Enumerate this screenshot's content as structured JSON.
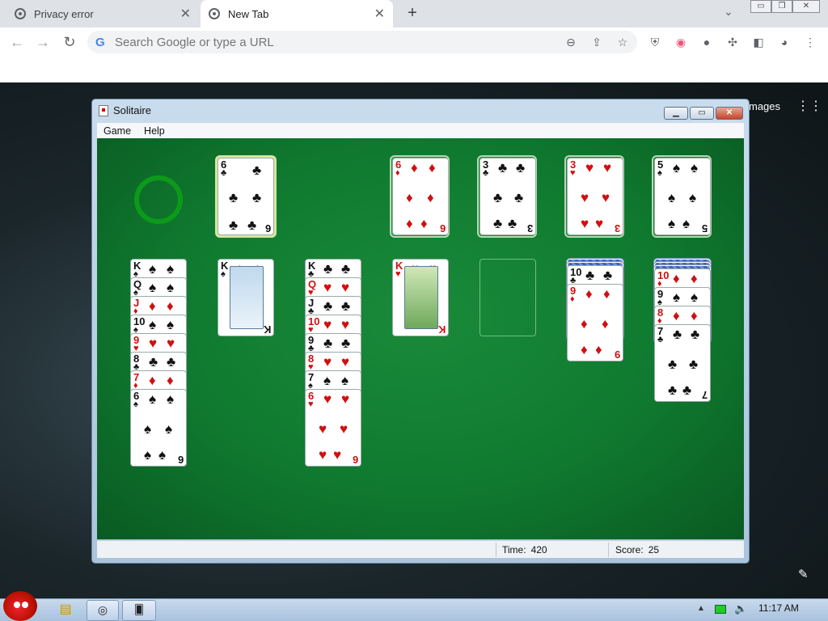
{
  "browser": {
    "tabs": [
      {
        "title": "Privacy error",
        "active": false
      },
      {
        "title": "New Tab",
        "active": true
      }
    ],
    "omnibox_placeholder": "Search Google or type a URL",
    "ntp_images_link": "mages"
  },
  "solitaire": {
    "title": "Solitaire",
    "menu": [
      "Game",
      "Help"
    ],
    "time_label": "Time:",
    "time_value": "420",
    "score_label": "Score:",
    "score_value": "25",
    "waste": {
      "rank": "6",
      "suit": "♣",
      "color": "black"
    },
    "foundations": [
      {
        "rank": "6",
        "suit": "♦",
        "color": "red"
      },
      {
        "rank": "3",
        "suit": "♣",
        "color": "black"
      },
      {
        "rank": "3",
        "suit": "♥",
        "color": "red"
      },
      {
        "rank": "5",
        "suit": "♠",
        "color": "black"
      }
    ],
    "tableau": [
      {
        "hidden": 0,
        "cards": [
          [
            "K",
            "♠"
          ],
          [
            "Q",
            "♠"
          ],
          [
            "J",
            "♦"
          ],
          [
            "10",
            "♠"
          ],
          [
            "9",
            "♥"
          ],
          [
            "8",
            "♣"
          ],
          [
            "7",
            "♦"
          ],
          [
            "6",
            "♠"
          ]
        ]
      },
      {
        "hidden": 0,
        "cards": [
          [
            "K",
            "♠"
          ]
        ]
      },
      {
        "hidden": 0,
        "cards": [
          [
            "K",
            "♣"
          ],
          [
            "Q",
            "♥"
          ],
          [
            "J",
            "♣"
          ],
          [
            "10",
            "♥"
          ],
          [
            "9",
            "♣"
          ],
          [
            "8",
            "♥"
          ],
          [
            "7",
            "♠"
          ],
          [
            "6",
            "♥"
          ]
        ]
      },
      {
        "hidden": 0,
        "cards": [
          [
            "K",
            "♥"
          ]
        ]
      },
      {
        "hidden": 0,
        "cards": []
      },
      {
        "hidden": 2,
        "cards": [
          [
            "10",
            "♣"
          ],
          [
            "9",
            "♦"
          ]
        ]
      },
      {
        "hidden": 3,
        "cards": [
          [
            "10",
            "♦"
          ],
          [
            "9",
            "♠"
          ],
          [
            "8",
            "♦"
          ],
          [
            "7",
            "♣"
          ]
        ]
      }
    ]
  },
  "taskbar": {
    "clock": "11:17 AM"
  }
}
